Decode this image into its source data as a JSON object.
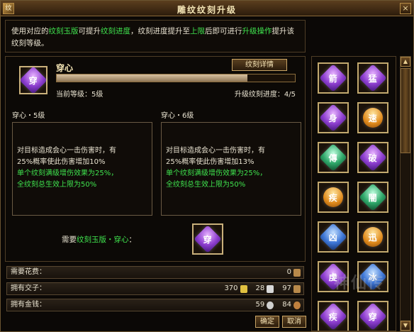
{
  "window": {
    "title": "雕纹纹刻升级",
    "close": "×",
    "system_icon": "纹"
  },
  "description": {
    "p1": "使用对应的",
    "g1": "纹刻玉版",
    "p2": "可提升",
    "g2": "纹刻进度",
    "p3": "，纹刻进度提升至",
    "g3": "上限",
    "p4": "后即可进行",
    "g4": "升级操作",
    "p5": "提升该纹刻等级。"
  },
  "rune": {
    "name": "穿心",
    "icon": "穿",
    "detail_button": "纹刻详情",
    "current_level": "当前等级：5级",
    "upgrade_progress": "升级纹刻进度：4/5",
    "progress_fraction": 0.8
  },
  "levels": [
    {
      "title": "穿心・5级",
      "line1": "对目标造成会心一击伤害时，有",
      "line2": "25%概率使此伤害增加10%",
      "line3": "单个纹刻满级增伤效果为25%，",
      "line4": "全纹刻总生效上限为50%"
    },
    {
      "title": "穿心・6级",
      "line1": "对目标造成会心一击伤害时，有",
      "line2": "25%概率使此伤害增加13%",
      "line3": "单个纹刻满级增伤效果为25%，",
      "line4": "全纹刻总生效上限为50%"
    }
  ],
  "requirement": {
    "prefix": "需要",
    "item": "纹刻玉版・穿心",
    "suffix": "：",
    "icon": "穿"
  },
  "resources": {
    "cost": {
      "label": "需要花费：",
      "value": "0"
    },
    "coins": {
      "label": "拥有交子：",
      "v1": "370",
      "v2": "28",
      "v3": "97"
    },
    "money": {
      "label": "拥有金钱：",
      "v1": "59",
      "v2": "84"
    }
  },
  "buttons": {
    "confirm": "确定",
    "cancel": "取消"
  },
  "inventory": [
    {
      "glyph": "箭",
      "style": "purple"
    },
    {
      "glyph": "猛",
      "style": "purple"
    },
    {
      "glyph": "身",
      "style": "purple"
    },
    {
      "glyph": "速",
      "style": "gold"
    },
    {
      "glyph": "傳",
      "style": "green"
    },
    {
      "glyph": "破",
      "style": "purple"
    },
    {
      "glyph": "疾",
      "style": "gold"
    },
    {
      "glyph": "闇",
      "style": "green"
    },
    {
      "glyph": "凶",
      "style": "blue"
    },
    {
      "glyph": "迅",
      "style": "gold"
    },
    {
      "glyph": "虔",
      "style": "purple"
    },
    {
      "glyph": "冰",
      "style": "blue"
    },
    {
      "glyph": "疾",
      "style": "purple"
    },
    {
      "glyph": "穿",
      "style": "purple"
    }
  ],
  "watermark": "神仙传"
}
